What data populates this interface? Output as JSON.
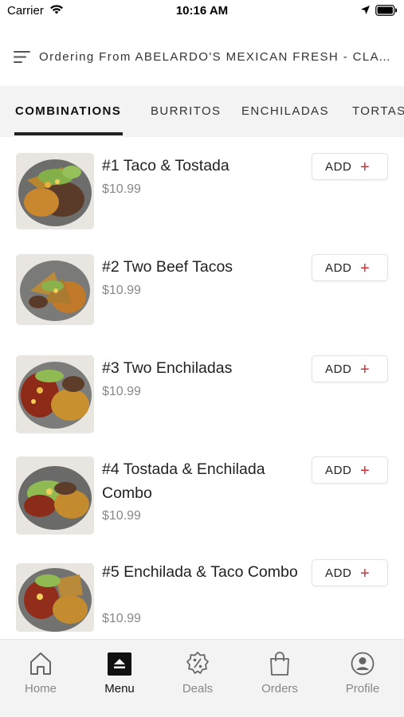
{
  "status_bar": {
    "carrier": "Carrier",
    "time": "10:16 AM"
  },
  "header": {
    "title": "Ordering From ABELARDO'S MEXICAN FRESH - CLAY..."
  },
  "tabs": [
    {
      "label": "COMBINATIONS",
      "active": true
    },
    {
      "label": "BURRITOS",
      "active": false
    },
    {
      "label": "ENCHILADAS",
      "active": false
    },
    {
      "label": "TORTAS",
      "active": false
    }
  ],
  "items": [
    {
      "name": "#1 Taco & Tostada",
      "price": "$10.99",
      "add_label": "ADD"
    },
    {
      "name": "#2 Two Beef Tacos",
      "price": "$10.99",
      "add_label": "ADD"
    },
    {
      "name": "#3 Two Enchiladas",
      "price": "$10.99",
      "add_label": "ADD"
    },
    {
      "name": "#4 Tostada & Enchilada Combo",
      "price": "$10.99",
      "add_label": "ADD"
    },
    {
      "name": "#5 Enchilada & Taco Combo",
      "price": "$10.99",
      "add_label": "ADD"
    }
  ],
  "bottom_nav": [
    {
      "label": "Home",
      "icon": "home-icon",
      "active": false
    },
    {
      "label": "Menu",
      "icon": "menu-icon",
      "active": true
    },
    {
      "label": "Deals",
      "icon": "deals-icon",
      "active": false
    },
    {
      "label": "Orders",
      "icon": "orders-icon",
      "active": false
    },
    {
      "label": "Profile",
      "icon": "profile-icon",
      "active": false
    }
  ],
  "colors": {
    "accent": "#d32f2f",
    "tab_bar_bg": "#f3f3f3",
    "price": "#888888",
    "text": "#222222"
  }
}
